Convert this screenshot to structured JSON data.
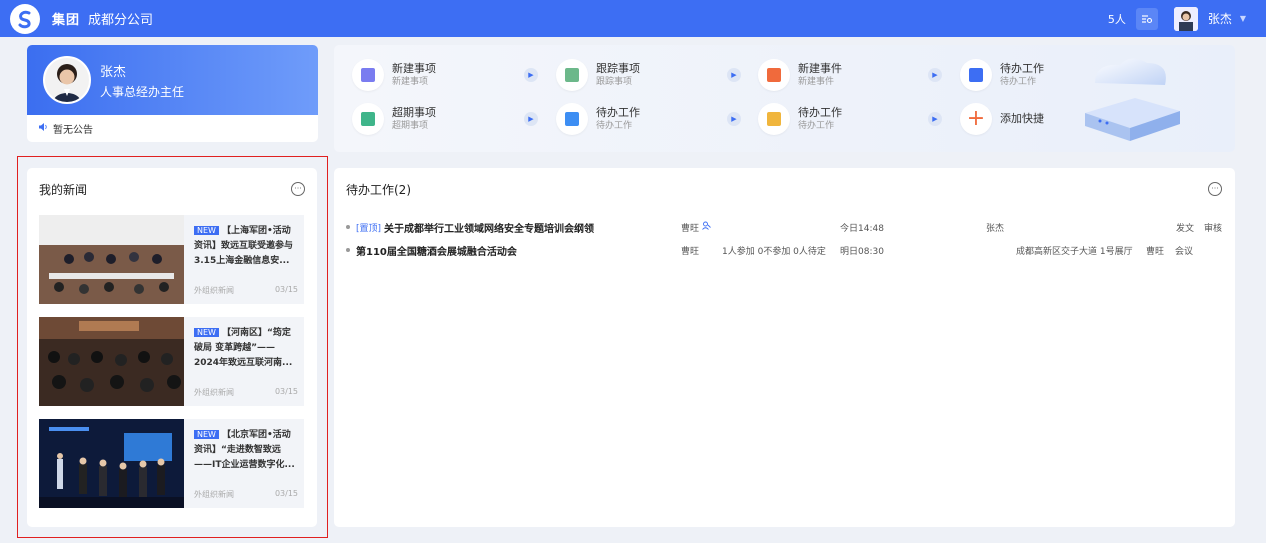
{
  "topbar": {
    "brand": "集团",
    "org": "成都分公司",
    "online": "5人",
    "user_name": "张杰",
    "accent": "#3d6ef3"
  },
  "profile": {
    "name": "张杰",
    "title": "人事总经办主任",
    "notice": "暂无公告"
  },
  "quick_actions": [
    {
      "label": "新建事项",
      "sub": "新建事项",
      "color": "#7a7cf0"
    },
    {
      "label": "跟踪事项",
      "sub": "跟踪事项",
      "color": "#6cb88a"
    },
    {
      "label": "新建事件",
      "sub": "新建事件",
      "color": "#f06a3c"
    },
    {
      "label": "待办工作",
      "sub": "待办工作",
      "color": "#3d6ef3"
    },
    {
      "label": "超期事项",
      "sub": "超期事项",
      "color": "#3fb58a"
    },
    {
      "label": "待办工作",
      "sub": "待办工作",
      "color": "#3d8ef3"
    },
    {
      "label": "待办工作",
      "sub": "待办工作",
      "color": "#f0b53c"
    },
    {
      "label": "添加快捷",
      "sub": "",
      "color": "#f06a3c"
    }
  ],
  "news": {
    "title": "我的新闻",
    "items": [
      {
        "tag": "NEW",
        "text": "【上海军团•活动资讯】致远互联受邀参与3.15上海金融信息安...",
        "source": "外组织新闻",
        "date": "03/15"
      },
      {
        "tag": "NEW",
        "text": "【河南区】“筠定破局 变革跨越”——2024年致远互联河南...",
        "source": "外组织新闻",
        "date": "03/15"
      },
      {
        "tag": "NEW",
        "text": "【北京军团•活动资讯】“走进数智致远——IT企业运营数字化...",
        "source": "外组织新闻",
        "date": "03/15"
      }
    ]
  },
  "todo": {
    "title": "待办工作(2)",
    "rows": [
      {
        "pin": "[置顶]",
        "title": "关于成都举行工业领域网络安全专题培训会纲领",
        "sender": "曹旺",
        "attend": "",
        "time": "今日14:48",
        "person": "张杰",
        "location": "",
        "owner": "",
        "type": "发文",
        "action": "审核"
      },
      {
        "pin": "",
        "title": "第110届全国糖酒会展城融合活动会",
        "sender": "曹旺",
        "attend": "1人参加 0不参加 0人待定",
        "time": "明日08:30",
        "person": "",
        "location": "成都高新区交子大道 1号展厅",
        "owner": "曹旺",
        "type": "会议",
        "action": ""
      }
    ]
  }
}
